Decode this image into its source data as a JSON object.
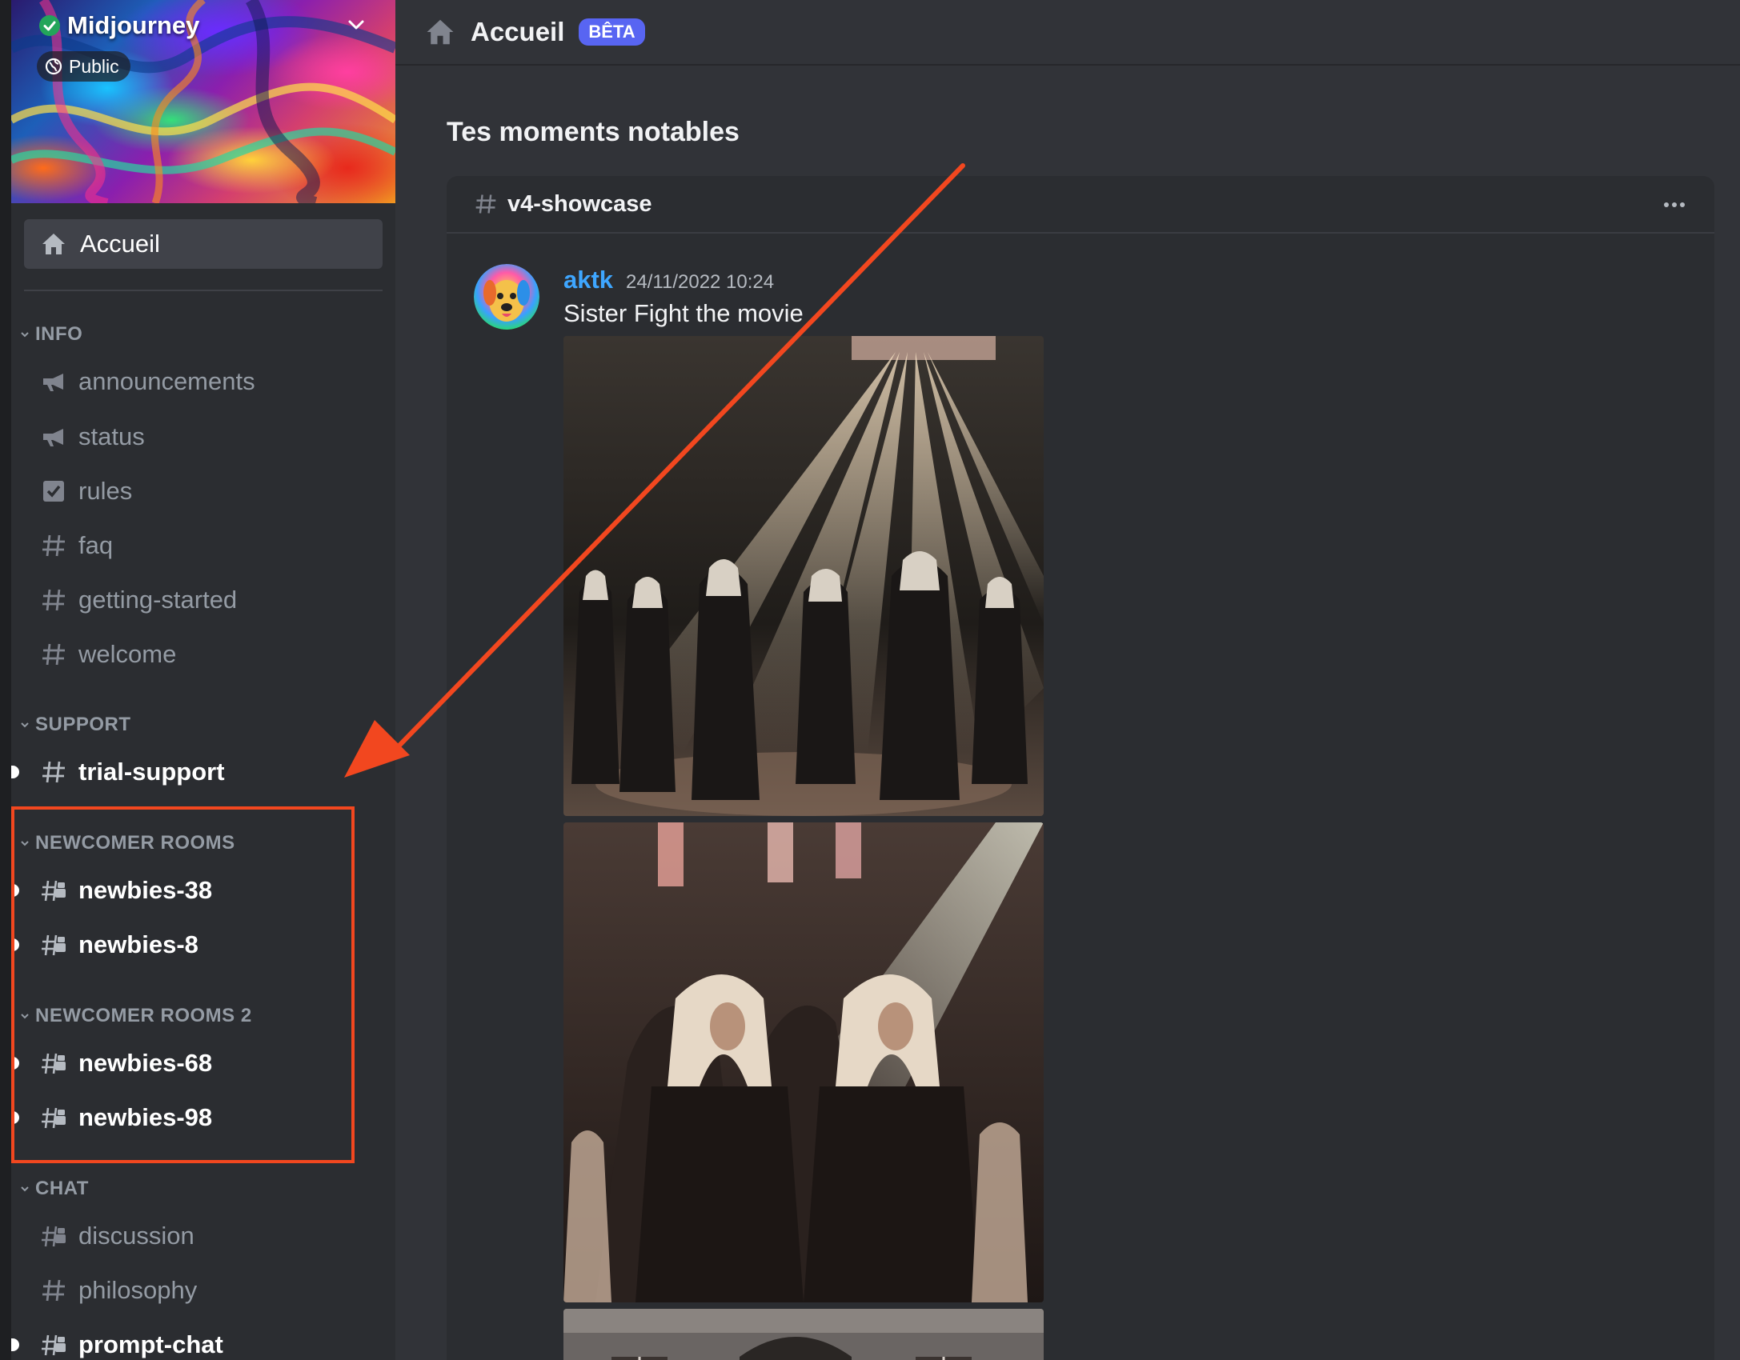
{
  "server": {
    "name": "Midjourney",
    "visibility": "Public"
  },
  "sidebar": {
    "home_label": "Accueil",
    "categories": [
      {
        "label": "INFO",
        "channels": [
          "announcements",
          "status",
          "rules",
          "faq",
          "getting-started",
          "welcome"
        ]
      },
      {
        "label": "SUPPORT",
        "channels": [
          "trial-support"
        ]
      },
      {
        "label": "NEWCOMER ROOMS",
        "channels": [
          "newbies-38",
          "newbies-8"
        ]
      },
      {
        "label": "NEWCOMER ROOMS 2",
        "channels": [
          "newbies-68",
          "newbies-98"
        ]
      },
      {
        "label": "CHAT",
        "channels": [
          "discussion",
          "philosophy",
          "prompt-chat"
        ]
      }
    ]
  },
  "header": {
    "title": "Accueil",
    "badge": "BÊTA"
  },
  "main": {
    "section_title": "Tes moments notables",
    "card": {
      "channel": "v4-showcase",
      "message": {
        "author": "aktk",
        "timestamp": "24/11/2022 10:24",
        "text": "Sister Fight the movie"
      }
    }
  },
  "colors": {
    "accent": "#5865f2",
    "author": "#3ea6ff",
    "annotation": "#f2471f"
  },
  "icons": [
    "verified-check-icon",
    "chevron-down-icon",
    "globe-icon",
    "home-icon",
    "megaphone-icon",
    "checkbox-icon",
    "hashtag-icon",
    "forum-channel-icon",
    "more-options-icon"
  ]
}
